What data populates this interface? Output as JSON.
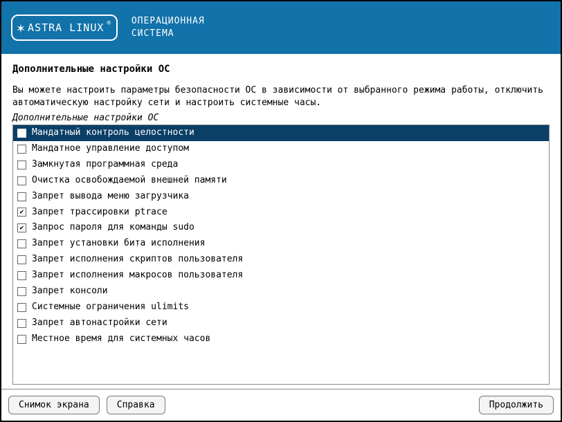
{
  "header": {
    "logo_text": "ASTRA LINUX",
    "subtitle_line1": "ОПЕРАЦИОННАЯ",
    "subtitle_line2": "СИСТЕМА"
  },
  "page": {
    "title": "Дополнительные настройки ОС",
    "description": "Вы можете настроить параметры безопасности ОС в зависимости от выбранного режима работы, отключить автоматическую настройку сети и настроить системные часы.",
    "section_label": "Дополнительные настройки ОС"
  },
  "options": [
    {
      "label": "Мандатный контроль целостности",
      "checked": false,
      "selected": true
    },
    {
      "label": "Мандатное управление доступом",
      "checked": false,
      "selected": false
    },
    {
      "label": "Замкнутая программная среда",
      "checked": false,
      "selected": false
    },
    {
      "label": "Очистка освобождаемой внешней памяти",
      "checked": false,
      "selected": false
    },
    {
      "label": "Запрет вывода меню загрузчика",
      "checked": false,
      "selected": false
    },
    {
      "label": "Запрет трассировки ptrace",
      "checked": true,
      "selected": false
    },
    {
      "label": "Запрос пароля для команды sudo",
      "checked": true,
      "selected": false
    },
    {
      "label": "Запрет установки бита исполнения",
      "checked": false,
      "selected": false
    },
    {
      "label": "Запрет исполнения скриптов пользователя",
      "checked": false,
      "selected": false
    },
    {
      "label": "Запрет исполнения макросов пользователя",
      "checked": false,
      "selected": false
    },
    {
      "label": "Запрет консоли",
      "checked": false,
      "selected": false
    },
    {
      "label": "Системные ограничения ulimits",
      "checked": false,
      "selected": false
    },
    {
      "label": "Запрет автонастройки сети",
      "checked": false,
      "selected": false
    },
    {
      "label": "Местное время для системных часов",
      "checked": false,
      "selected": false
    }
  ],
  "footer": {
    "screenshot": "Снимок экрана",
    "help": "Справка",
    "continue": "Продолжить"
  }
}
